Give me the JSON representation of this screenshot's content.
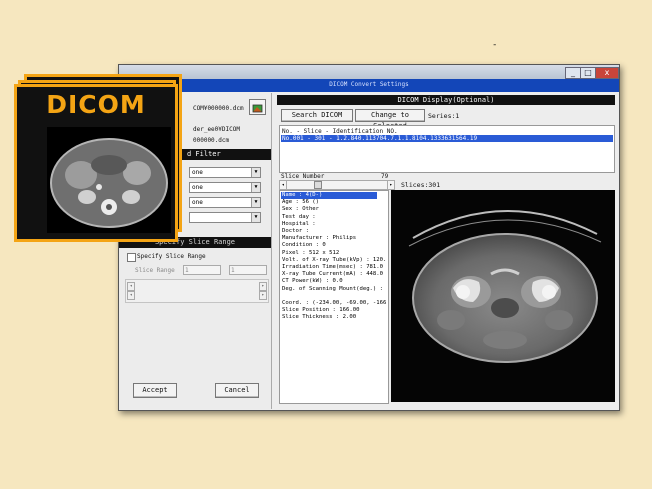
{
  "colors": {
    "background": "#f6e7bf",
    "accent_orange": "#f4a414",
    "title_blue": "#1346b8",
    "selection": "#2a5bd6"
  },
  "dash": "-",
  "titlebar": {
    "controls": [
      "_",
      "□",
      "x"
    ]
  },
  "left_panel": {
    "file_path_1": "COM¥000000.dcm",
    "file_path_2": "der_ee0¥DICOM",
    "file_path_3": "000000.dcm",
    "filter_header": "d Filter",
    "filter_values": [
      "one",
      "one",
      "one",
      ""
    ],
    "slice_range_header": "Specify Slice Range",
    "specify_checkbox_label": "Specify Slice Range",
    "slice_range_label": "Slice Range",
    "slice_range_from": "1",
    "slice_range_to": "1",
    "accept_label": "Accept",
    "cancel_label": "Cancel"
  },
  "dialog": {
    "title": "DICOM Convert Settings"
  },
  "right_panel": {
    "header": "DICOM Display(Optional)",
    "search_button": "Search DICOM",
    "change_button": "Change to Selected",
    "series_label": "Series:1",
    "list_header": "No.   - Slice - Identification NO.",
    "list_row": "No.001  -  301 - 1.2.840.113704.7.1.1.8104.1333631564.19",
    "slice_number_label": "Slice Number",
    "slice_number_value": "79",
    "slices_total": "Slices:301",
    "info_lines": [
      "Name : 4(D-)",
      "Age : 56 ()",
      "Sex : Other",
      "Test day :",
      "Hospital :",
      "Doctor :",
      "Manufacturer : Philips",
      "Condition : 0",
      "Pixel : 512 x 512",
      "Volt. of X-ray Tube(kVp) : 120.",
      "Irradiation Time(msec) : 781.0",
      "X-ray Tube Current(mA) : 448.0",
      "CT Power(kW) : 0.0",
      "Deg. of Scanning Mount(deg.) :",
      "",
      "Coord. : (-234.00, -69.00, -166",
      "Slice Position : 166.00",
      "Slice Thickness : 2.00"
    ]
  },
  "badge": {
    "label": "DICOM"
  }
}
